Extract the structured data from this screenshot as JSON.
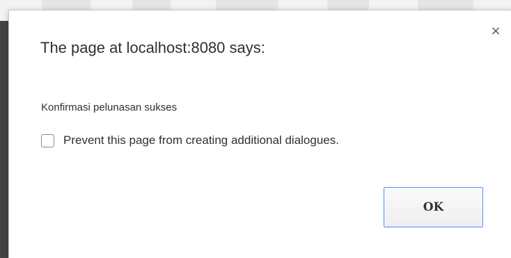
{
  "dialog": {
    "title": "The page at localhost:8080 says:",
    "close_symbol": "×",
    "message": "Konfirmasi pelunasan sukses",
    "checkbox": {
      "label": "Prevent this page from creating additional dialogues.",
      "checked": false
    },
    "ok_label": "OK",
    "accent_color": "#4d90fe"
  }
}
